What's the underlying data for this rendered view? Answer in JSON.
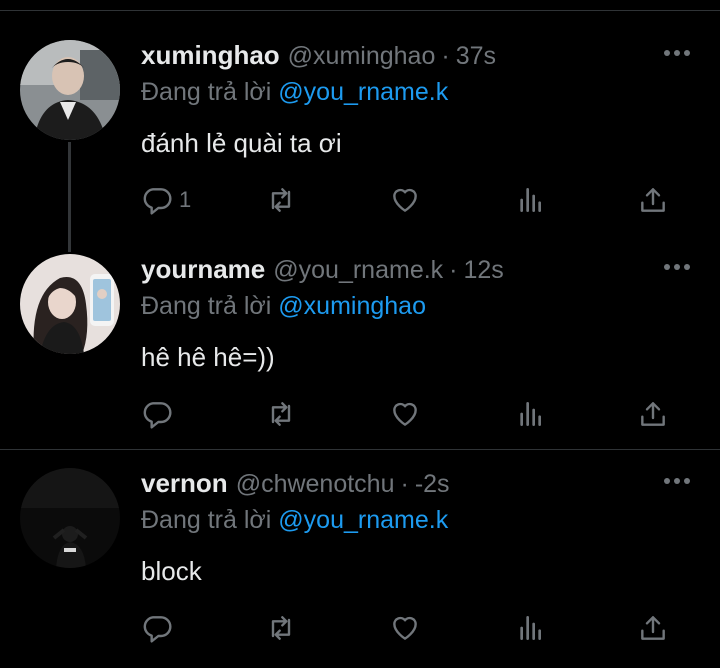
{
  "tweets": [
    {
      "name": "xuminghao",
      "handle": "@xuminghao",
      "separator": "·",
      "time": "37s",
      "reply_prefix": "Đang trả lời",
      "reply_to": "@you_rname.k",
      "text": "đánh lẻ quài ta ơi",
      "reply_count": "1"
    },
    {
      "name": "yourname",
      "handle": "@you_rname.k",
      "separator": "·",
      "time": "12s",
      "reply_prefix": "Đang trả lời",
      "reply_to": "@xuminghao",
      "text": "hê hê hê=))",
      "reply_count": ""
    },
    {
      "name": "vernon",
      "handle": "@chwenotchu",
      "separator": "·",
      "time": "-2s",
      "reply_prefix": "Đang trả lời",
      "reply_to": "@you_rname.k",
      "text": "block",
      "reply_count": ""
    }
  ],
  "icons": {
    "reply": "reply-icon",
    "retweet": "retweet-icon",
    "like": "heart-icon",
    "views": "analytics-icon",
    "share": "share-icon",
    "more": "more-icon"
  },
  "colors": {
    "background": "#000000",
    "text": "#e7e9ea",
    "muted": "#71767b",
    "mention": "#1d9bf0"
  }
}
